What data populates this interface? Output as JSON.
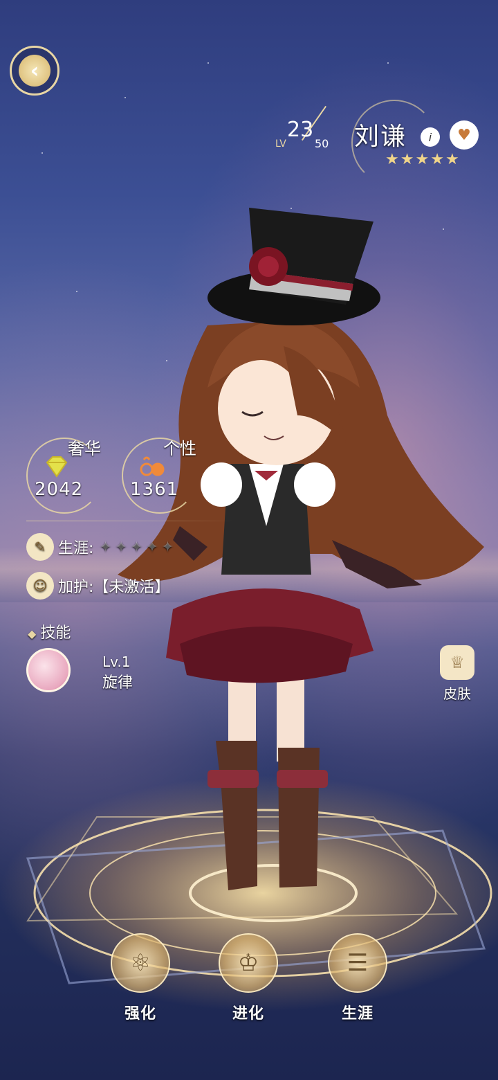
{
  "header": {
    "back_icon": "back-wing-icon",
    "level_prefix": "LV",
    "level_current": "23",
    "level_max": "50",
    "character_name": "刘谦",
    "edit_icon": "edit-icon",
    "lock_icon": "lock-heart-icon",
    "star_rating": 5
  },
  "stats": [
    {
      "label": "奢华",
      "value": "2042",
      "icon": "diamond-icon"
    },
    {
      "label": "个性",
      "value": "1361",
      "icon": "glasses-icon"
    }
  ],
  "career": {
    "label": "生涯:",
    "icon": "career-icon"
  },
  "guard": {
    "label": "加护:",
    "status": "【未激活】",
    "icon": "ghost-icon"
  },
  "skills": {
    "title": "技能",
    "items": [
      {
        "level": "Lv.1",
        "name": "旋律",
        "icon": "melody-skill-icon"
      }
    ]
  },
  "skin": {
    "label": "皮肤",
    "icon": "skin-icon"
  },
  "bottom_buttons": [
    {
      "label": "强化",
      "icon": "enhance-icon"
    },
    {
      "label": "进化",
      "icon": "evolve-icon"
    },
    {
      "label": "生涯",
      "icon": "career-book-icon"
    }
  ],
  "colors": {
    "accent_gold": "#e8d6a4",
    "sky_top": "#2f3d7e",
    "sky_bottom": "#1c2550"
  }
}
